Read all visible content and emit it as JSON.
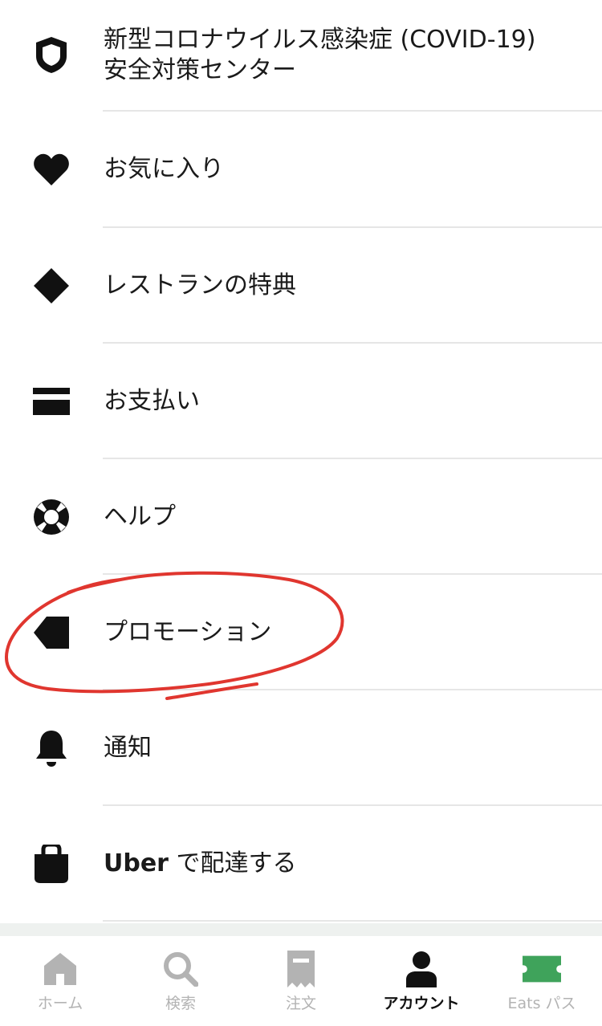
{
  "menu": {
    "items": [
      {
        "label_line1": "新型コロナウイルス感染症 (COVID-19)",
        "label_line2": "安全対策センター",
        "icon": "shield-icon"
      },
      {
        "label": "お気に入り",
        "icon": "heart-icon"
      },
      {
        "label": "レストランの特典",
        "icon": "diamond-icon"
      },
      {
        "label": "お支払い",
        "icon": "credit-card-icon"
      },
      {
        "label": "ヘルプ",
        "icon": "lifebuoy-icon"
      },
      {
        "label": "プロモーション",
        "icon": "tag-icon"
      },
      {
        "label": "通知",
        "icon": "bell-icon"
      },
      {
        "label_bold": "Uber",
        "label_rest": " で配達する",
        "icon": "bag-icon"
      }
    ]
  },
  "tabbar": {
    "tabs": [
      {
        "label": "ホーム",
        "icon": "home-icon"
      },
      {
        "label": "検索",
        "icon": "search-icon"
      },
      {
        "label": "注文",
        "icon": "receipt-icon"
      },
      {
        "label": "アカウント",
        "icon": "person-icon",
        "active": true
      },
      {
        "label": "Eats パス",
        "icon": "ticket-icon"
      }
    ]
  },
  "colors": {
    "text": "#1a1a1a",
    "divider": "#e6e6e6",
    "tab_inactive": "#b3b3b3",
    "tab_active": "#111111",
    "eats_pass_green": "#3fa35b",
    "annotation_red": "#e0362f"
  }
}
